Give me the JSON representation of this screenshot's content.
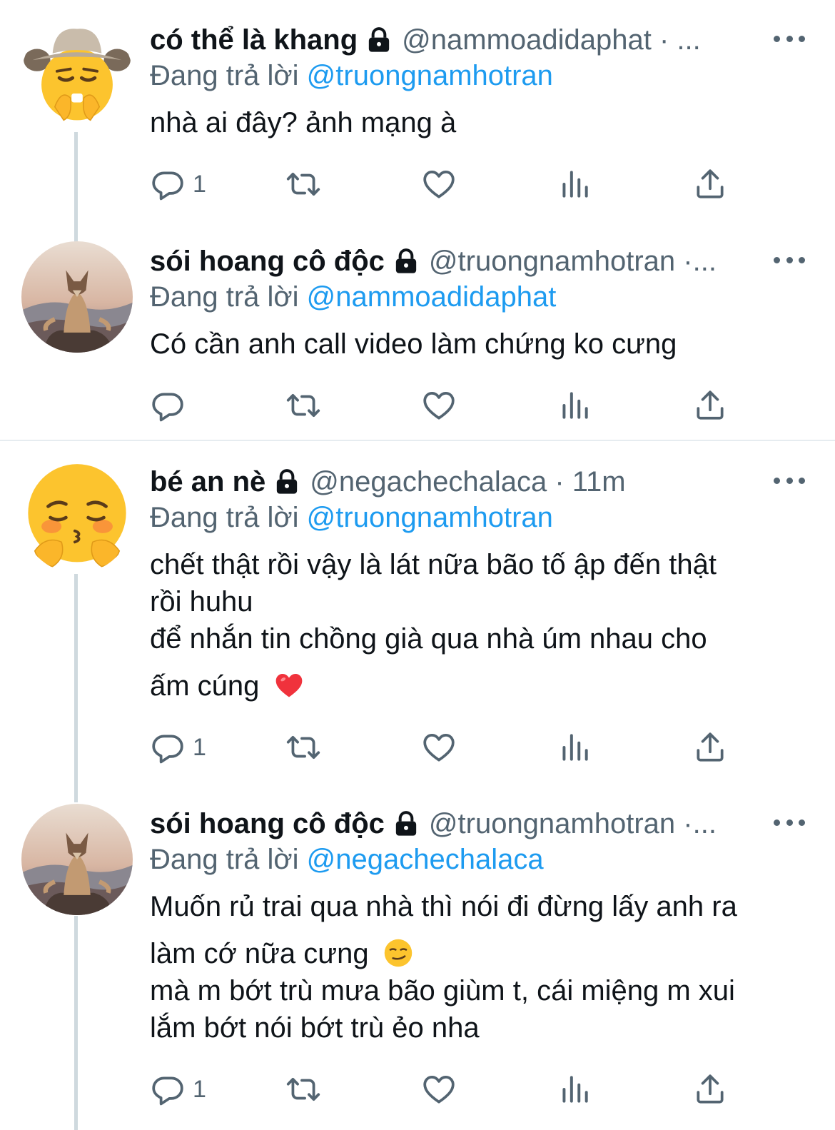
{
  "colors": {
    "accent": "#1d9bf0",
    "secondary_text": "#536471",
    "primary_text": "#0f1419",
    "thread_line": "#cfd9de"
  },
  "tweets": [
    {
      "display_name": "có thể là khang",
      "handle_meta": "@nammoadidaphat · ...",
      "replying_prefix": "Đang trả lời",
      "replying_to": "@truongnamhotran",
      "body_lines": [
        "nhà ai đây? ảnh mạng à"
      ],
      "reply_count": "1",
      "avatar": "cowboy-pleading-emoji-avatar",
      "locked": true
    },
    {
      "display_name": "sói hoang cô độc",
      "handle_meta": "@truongnamhotran ·...",
      "replying_prefix": "Đang trả lời",
      "replying_to": "@nammoadidaphat",
      "body_lines": [
        "Có cần anh call video làm chứng ko cưng"
      ],
      "reply_count": "",
      "avatar": "meditating-wolf-avatar",
      "locked": true
    },
    {
      "display_name": "bé an nè",
      "handle_meta": "@negachechalaca · 11m",
      "replying_prefix": "Đang trả lời",
      "replying_to": "@truongnamhotran",
      "body_lines": [
        "chết thật rồi vậy là lát nữa bão tố ập đến thật",
        "rồi huhu",
        "để nhắn tin chồng già qua nhà úm nhau cho",
        "ấm cúng"
      ],
      "body_emoji": "red-heart-emoji",
      "reply_count": "1",
      "avatar": "blushing-hug-emoji-avatar",
      "locked": true
    },
    {
      "display_name": "sói hoang cô độc",
      "handle_meta": "@truongnamhotran ·...",
      "replying_prefix": "Đang trả lời",
      "replying_to": "@negachechalaca",
      "body_lines": [
        "Muốn rủ trai qua nhà thì nói đi đừng lấy anh ra",
        "làm cớ nữa cưng",
        "mà m bớt trù mưa bão giùm t, cái miệng m xui",
        "lắm bớt nói bớt trù ẻo nha"
      ],
      "body_emoji": "smirking-face-emoji",
      "reply_count": "1",
      "avatar": "meditating-wolf-avatar",
      "locked": true
    }
  ]
}
